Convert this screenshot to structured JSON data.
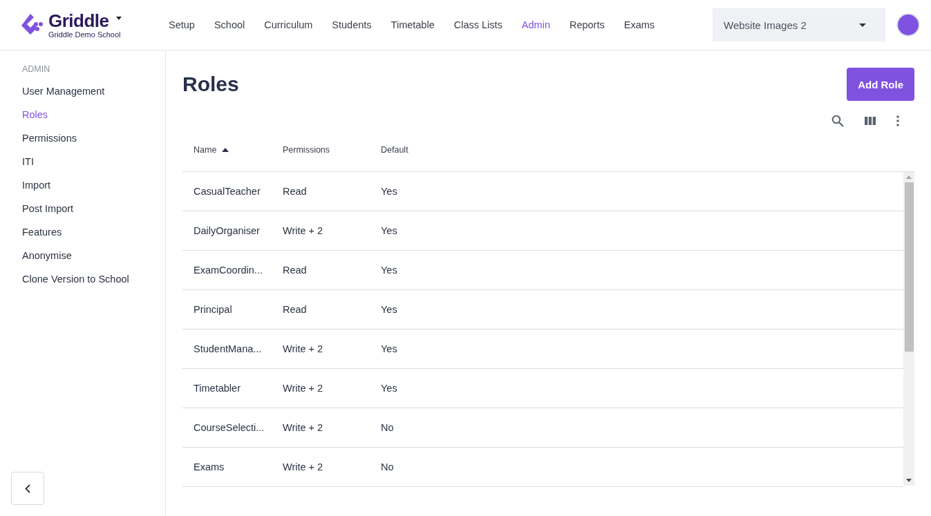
{
  "brand": {
    "name": "Griddle",
    "school": "Griddle Demo School"
  },
  "nav": [
    {
      "label": "Setup",
      "selected": false
    },
    {
      "label": "School",
      "selected": false
    },
    {
      "label": "Curriculum",
      "selected": false
    },
    {
      "label": "Students",
      "selected": false
    },
    {
      "label": "Timetable",
      "selected": false
    },
    {
      "label": "Class Lists",
      "selected": false
    },
    {
      "label": "Admin",
      "selected": true
    },
    {
      "label": "Reports",
      "selected": false
    },
    {
      "label": "Exams",
      "selected": false
    }
  ],
  "version_select": {
    "value": "Website Images 2"
  },
  "sidebar": {
    "heading": "ADMIN",
    "items": [
      {
        "label": "User Management",
        "selected": false
      },
      {
        "label": "Roles",
        "selected": true
      },
      {
        "label": "Permissions",
        "selected": false
      },
      {
        "label": "ITI",
        "selected": false
      },
      {
        "label": "Import",
        "selected": false
      },
      {
        "label": "Post Import",
        "selected": false
      },
      {
        "label": "Features",
        "selected": false
      },
      {
        "label": "Anonymise",
        "selected": false
      },
      {
        "label": "Clone Version to School",
        "selected": false
      }
    ]
  },
  "page": {
    "title": "Roles",
    "add_button": "Add Role"
  },
  "table": {
    "columns": [
      {
        "label": "Name",
        "sorted_ascending": true
      },
      {
        "label": "Permissions",
        "sorted_ascending": false
      },
      {
        "label": "Default",
        "sorted_ascending": false
      }
    ],
    "rows": [
      [
        "CasualTeacher",
        "Read",
        "Yes"
      ],
      [
        "DailyOrganiser",
        "Write + 2",
        "Yes"
      ],
      [
        "ExamCoordin...",
        "Read",
        "Yes"
      ],
      [
        "Principal",
        "Read",
        "Yes"
      ],
      [
        "StudentMana...",
        "Write + 2",
        "Yes"
      ],
      [
        "Timetabler",
        "Write + 2",
        "Yes"
      ],
      [
        "CourseSelecti...",
        "Write + 2",
        "No"
      ],
      [
        "Exams",
        "Write + 2",
        "No"
      ]
    ]
  }
}
